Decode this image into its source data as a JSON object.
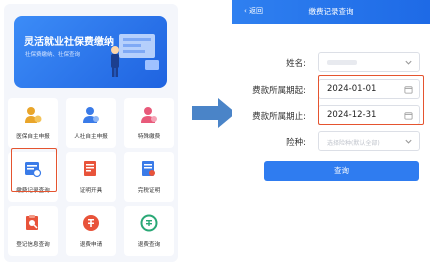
{
  "left_screen": {
    "banner": {
      "title": "灵活就业社保费缴纳",
      "subtitle": "社保费缴纳、社保查询"
    },
    "grid": [
      {
        "label": "医保自主申报",
        "icon": "medical-declare-icon",
        "color": "#e9a52a"
      },
      {
        "label": "人社自主申报",
        "icon": "hr-declare-icon",
        "color": "#3a7be8"
      },
      {
        "label": "特殊缴费",
        "icon": "special-payment-icon",
        "color": "#e85a7a"
      },
      {
        "label": "缴费记录查询",
        "icon": "payment-record-icon",
        "color": "#3a7be8"
      },
      {
        "label": "证明开具",
        "icon": "certificate-icon",
        "color": "#e8533a"
      },
      {
        "label": "完税证明",
        "icon": "tax-proof-icon",
        "color": "#3a7be8"
      },
      {
        "label": "登记信息查询",
        "icon": "registration-info-icon",
        "color": "#e8533a"
      },
      {
        "label": "退费申请",
        "icon": "refund-apply-icon",
        "color": "#e8533a"
      },
      {
        "label": "退费查询",
        "icon": "refund-query-icon",
        "color": "#2aa876"
      }
    ]
  },
  "right_screen": {
    "back_label": "返回",
    "title": "缴费记录查询",
    "form": {
      "name_label": "姓名:",
      "name_value": "",
      "start_label": "费款所属期起:",
      "start_value": "2024-01-01",
      "end_label": "费款所属期止:",
      "end_value": "2024-12-31",
      "type_label": "险种:",
      "type_placeholder": "选择险种(默认全部)"
    },
    "query_button": "查询"
  },
  "colors": {
    "primary": "#2f7cf0",
    "highlight": "#e5542f",
    "arrow": "#4a84c8"
  }
}
